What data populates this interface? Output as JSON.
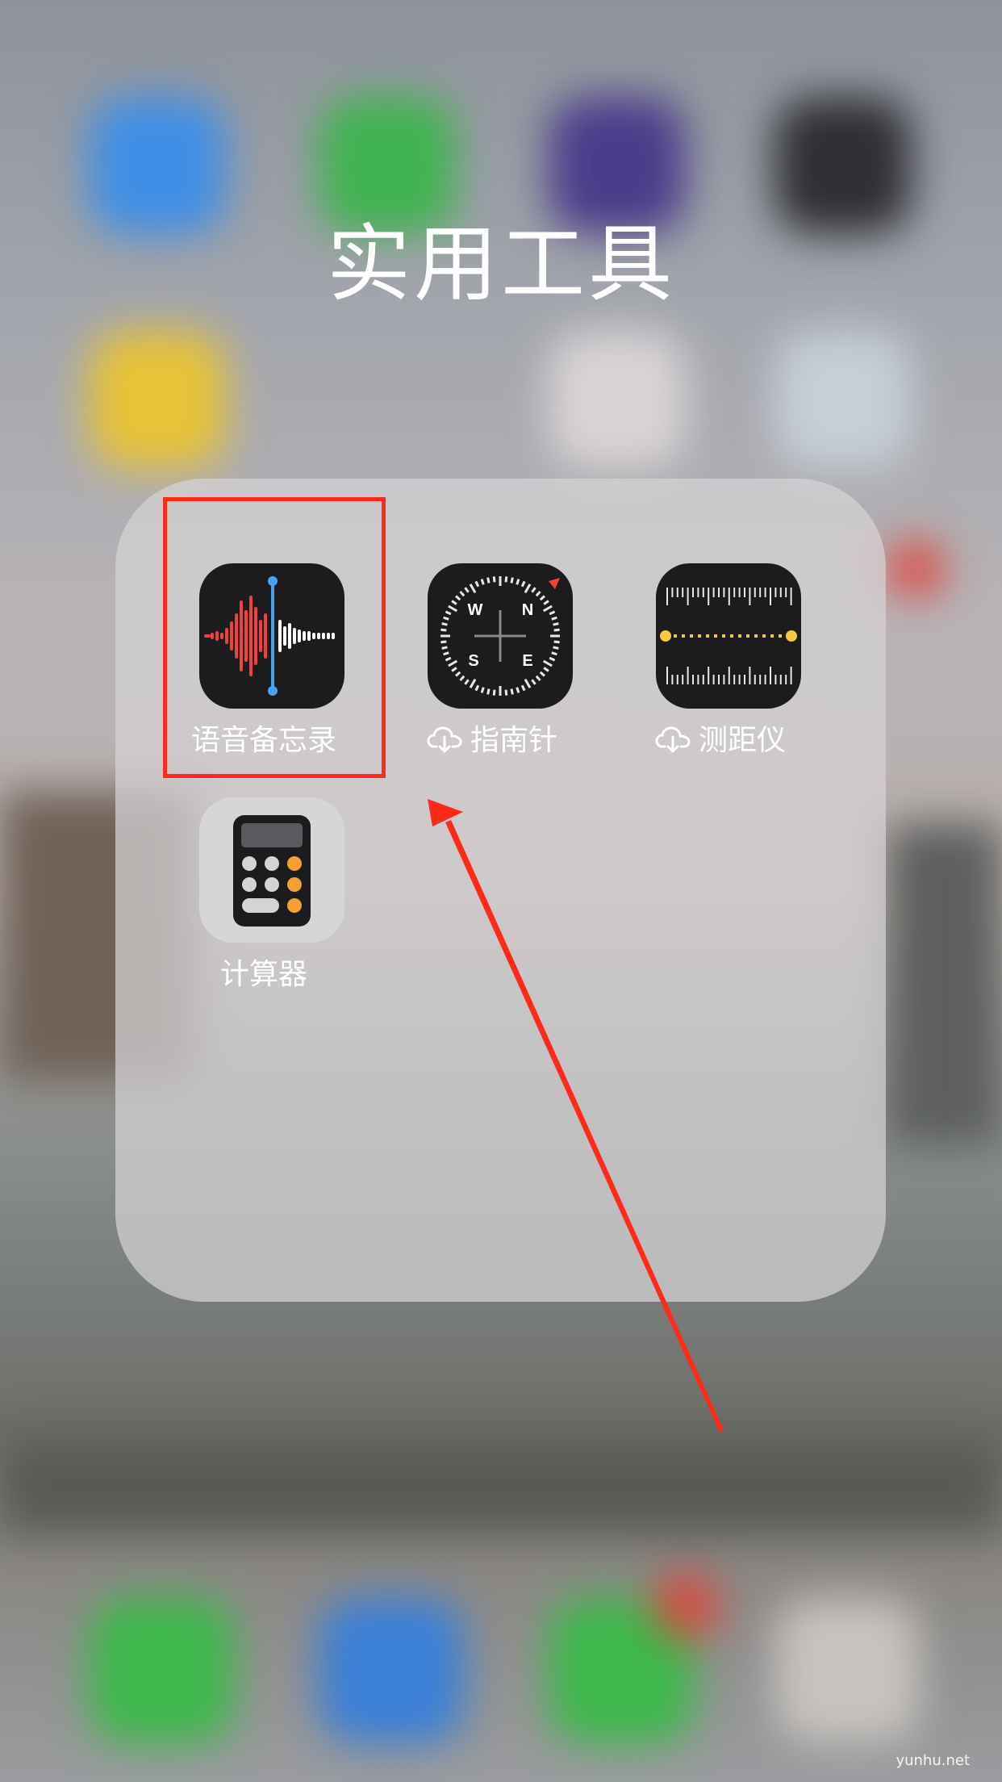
{
  "folder": {
    "title": "实用工具",
    "apps": [
      {
        "label": "语音备忘录",
        "icon": "voice-memos-icon",
        "downloading": false,
        "highlighted": true
      },
      {
        "label": "指南针",
        "icon": "compass-icon",
        "downloading": true,
        "compass_letters": [
          "W",
          "N",
          "S",
          "E"
        ]
      },
      {
        "label": "测距仪",
        "icon": "measure-icon",
        "downloading": true
      },
      {
        "label": "计算器",
        "icon": "calculator-icon",
        "downloading": false
      }
    ]
  },
  "annotation": {
    "highlight_color": "#ff2a1a",
    "arrow_color": "#ff2a1a"
  },
  "watermark": "yunhu.net"
}
